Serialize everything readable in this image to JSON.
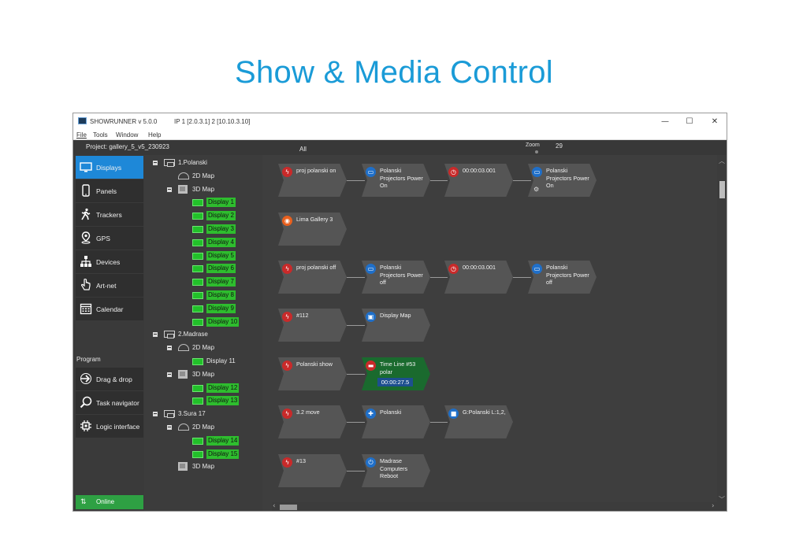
{
  "headline": "Show & Media Control",
  "window": {
    "title": "SHOWRUNNER  v 5.0.0",
    "ip_info": "IP  1 [2.0.3.1]  2 [10.10.3.10]",
    "controls": {
      "minimize": "—",
      "maximize": "☐",
      "close": "✕"
    }
  },
  "menu": {
    "file": "File",
    "tools": "Tools",
    "window": "Window",
    "help": "Help"
  },
  "topbar": {
    "project": "Project: gallery_5_v5_230923",
    "all": "All",
    "zoom_label": "Zoom",
    "zoom_value": "29"
  },
  "sidebar": {
    "items": [
      {
        "label": "Displays",
        "icon": "displays-icon",
        "active": true
      },
      {
        "label": "Panels",
        "icon": "tablet-icon"
      },
      {
        "label": "Trackers",
        "icon": "walking-person-icon"
      },
      {
        "label": "GPS",
        "icon": "location-pin-icon"
      },
      {
        "label": "Devices",
        "icon": "network-tree-icon"
      },
      {
        "label": "Art-net",
        "icon": "hand-pointer-icon"
      },
      {
        "label": "Calendar",
        "icon": "calendar-icon"
      }
    ],
    "program_label": "Program",
    "program_items": [
      {
        "label": "Drag & drop",
        "icon": "drag-arrow-icon"
      },
      {
        "label": "Task navigator",
        "icon": "magnifier-icon"
      },
      {
        "label": "Logic interface",
        "icon": "chip-icon"
      }
    ],
    "status": {
      "label": "Online",
      "icon": "up-down-arrows-icon",
      "color": "#2ea043"
    }
  },
  "tree": {
    "rows": [
      {
        "label": "1.Polanski",
        "kind": "node",
        "expand": true
      },
      {
        "label": "2D Map",
        "kind": "map"
      },
      {
        "label": "3D Map",
        "kind": "cube",
        "expand": true
      },
      {
        "label": "Display 1",
        "kind": "display",
        "hl": true
      },
      {
        "label": "Display 2",
        "kind": "display",
        "hl": true
      },
      {
        "label": "Display 3",
        "kind": "display",
        "hl": true
      },
      {
        "label": "Display 4",
        "kind": "display",
        "hl": true
      },
      {
        "label": "Display 5",
        "kind": "display",
        "hl": true
      },
      {
        "label": "Display 6",
        "kind": "display",
        "hl": true
      },
      {
        "label": "Display 7",
        "kind": "display",
        "hl": true
      },
      {
        "label": "Display 8",
        "kind": "display",
        "hl": true
      },
      {
        "label": "Display 9",
        "kind": "display",
        "hl": true
      },
      {
        "label": "Display 10",
        "kind": "display",
        "hl": true
      },
      {
        "label": "2.Madrase",
        "kind": "node",
        "expand": true
      },
      {
        "label": "2D Map",
        "kind": "map",
        "expand": true
      },
      {
        "label": "Display 11",
        "kind": "display",
        "hl": false
      },
      {
        "label": "3D Map",
        "kind": "cube",
        "expand": true
      },
      {
        "label": "Display 12",
        "kind": "display",
        "hl": true
      },
      {
        "label": "Display 13",
        "kind": "display",
        "hl": true
      },
      {
        "label": "3.Sura 17",
        "kind": "node",
        "expand": true
      },
      {
        "label": "2D Map",
        "kind": "map",
        "expand": true
      },
      {
        "label": "Display 14",
        "kind": "display",
        "hl": true
      },
      {
        "label": "Display 15",
        "kind": "display",
        "hl": true
      },
      {
        "label": "3D Map",
        "kind": "cube"
      }
    ]
  },
  "flow": {
    "rows": [
      [
        {
          "text": "proj polanski on",
          "icon": "lightning-icon",
          "color": "red"
        },
        {
          "text": "Polanski Projectors Power On",
          "icon": "projector-icon",
          "color": "blue"
        },
        {
          "text": "00:00:03.001",
          "icon": "clock-icon",
          "color": "red"
        },
        {
          "text": "Polanski Projectors Power On",
          "icon": "projector-icon",
          "color": "blue",
          "gear": true
        }
      ],
      [
        {
          "text": "Lima Gallery 3",
          "icon": "broadcast-icon",
          "color": "orange"
        }
      ],
      [
        {
          "text": "proj polanski off",
          "icon": "lightning-icon",
          "color": "red"
        },
        {
          "text": "Polanski Projectors Power off",
          "icon": "projector-icon",
          "color": "blue"
        },
        {
          "text": "00:00:03.001",
          "icon": "clock-icon",
          "color": "red"
        },
        {
          "text": "Polanski Projectors Power off",
          "icon": "projector-icon",
          "color": "blue"
        }
      ],
      [
        {
          "text": "#112",
          "icon": "lightning-icon",
          "color": "red"
        },
        {
          "text": "Display Map",
          "icon": "display-map-icon",
          "color": "blue"
        }
      ],
      [
        {
          "text": "Polanski show",
          "icon": "lightning-icon",
          "color": "red"
        },
        {
          "text": "Time Line #53 polar",
          "icon": "timeline-icon",
          "color": "red",
          "green": true,
          "timer": "00:00:27.5"
        }
      ],
      [
        {
          "text": "3.2 move",
          "icon": "lightning-icon",
          "color": "red"
        },
        {
          "text": "Polanski",
          "icon": "move-cross-icon",
          "color": "blue"
        },
        {
          "text": "G:Polanski L:1,2,",
          "icon": "stop-square-icon",
          "color": "blue"
        }
      ],
      [
        {
          "text": "#13",
          "icon": "lightning-icon",
          "color": "red"
        },
        {
          "text": "Madrase Computers Reboot",
          "icon": "power-icon",
          "color": "blue"
        }
      ]
    ]
  },
  "accent": "#1e88d8",
  "highlight": "#2ebd2e"
}
